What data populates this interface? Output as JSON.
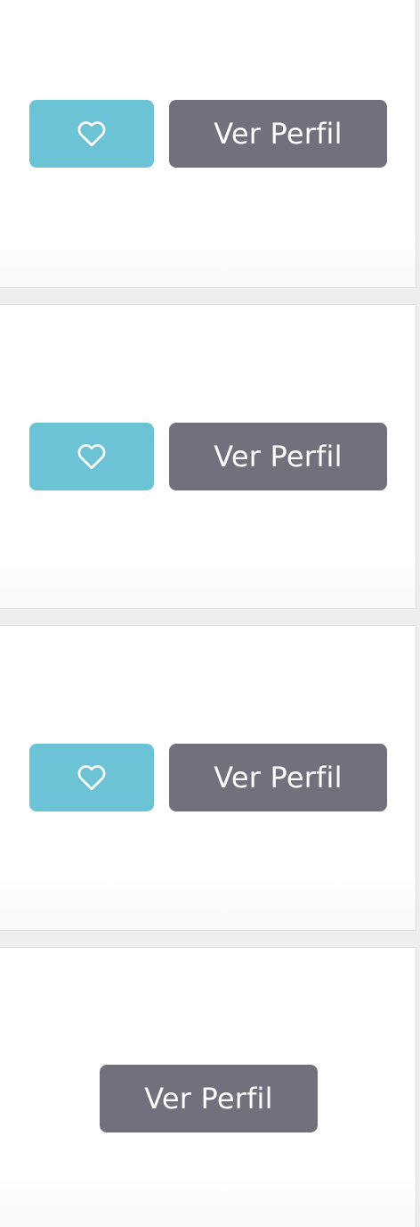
{
  "colors": {
    "favorite_button": "#6bc3d5",
    "profile_button": "#70717d",
    "card_background": "#ffffff",
    "page_background": "#eeeeee"
  },
  "cards": [
    {
      "favorite_icon": "heart-outline-icon",
      "profile_label": "Ver Perfil"
    },
    {
      "favorite_icon": "heart-outline-icon",
      "profile_label": "Ver Perfil"
    },
    {
      "favorite_icon": "heart-outline-icon",
      "profile_label": "Ver Perfil"
    },
    {
      "profile_label": "Ver Perfil"
    }
  ]
}
